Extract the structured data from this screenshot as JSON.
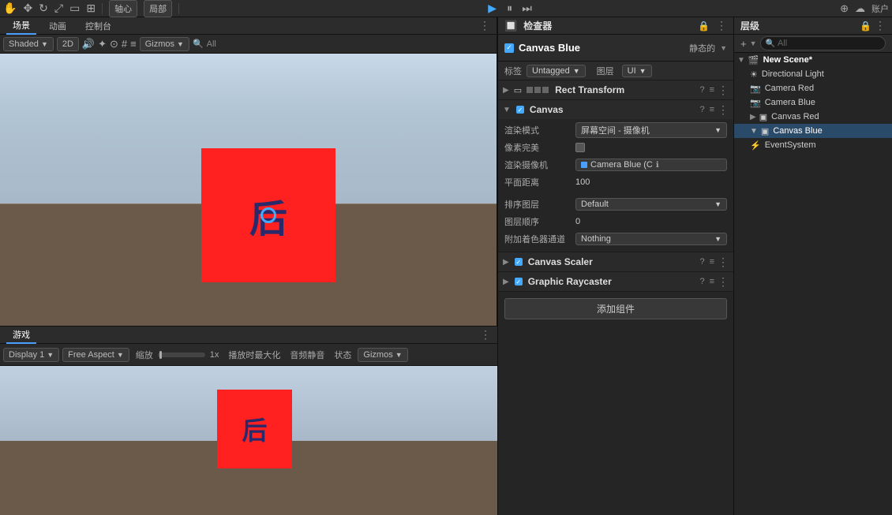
{
  "topbar": {
    "icons": [
      "hand",
      "move",
      "rotate",
      "scale",
      "rect",
      "transform"
    ],
    "axis_label": "轴心",
    "local_label": "局部",
    "play_btn": "▶",
    "pause_btn": "⏸",
    "step_btn": "⏭",
    "cloud_icon": "☁",
    "account_label": "账户",
    "collab_icon": "⊕",
    "settings_icon": "⚙"
  },
  "second_toolbar": {
    "shaded": "Shaded",
    "two_d": "2D",
    "gizmos": "Gizmos",
    "all": "All"
  },
  "left_panels": {
    "scene_tab": "场景",
    "animation_tab": "动画",
    "control_tab": "控制台"
  },
  "game_panel": {
    "tab": "游戏",
    "display": "Display 1",
    "aspect": "Free Aspect",
    "scale_label": "缩放",
    "scale_value": "1x",
    "maximize_label": "播放时最大化",
    "mute_label": "音频静音",
    "status_label": "状态",
    "gizmos_label": "Gizmos"
  },
  "inspector": {
    "title": "检查器",
    "object_name": "Canvas Blue",
    "static_label": "静态的",
    "tag_label": "标签",
    "tag_value": "Untagged",
    "layer_label": "图层",
    "layer_value": "UI",
    "components": {
      "rect_transform": {
        "title": "Rect Transform"
      },
      "canvas": {
        "title": "Canvas",
        "render_mode_label": "渲染模式",
        "render_mode_value": "屏幕空间 - 摄像机",
        "pixel_perfect_label": "像素完美",
        "render_camera_label": "渲染摄像机",
        "render_camera_value": "Camera Blue (C",
        "plane_distance_label": "平面距离",
        "plane_distance_value": "100",
        "sort_layer_label": "排序图层",
        "sort_layer_value": "Default",
        "layer_order_label": "图层顺序",
        "layer_order_value": "0",
        "add_shader_label": "附加着色器通道",
        "add_shader_value": "Nothing"
      },
      "canvas_scaler": {
        "title": "Canvas Scaler"
      },
      "graphic_raycaster": {
        "title": "Graphic Raycaster"
      }
    },
    "add_component_btn": "添加组件"
  },
  "hierarchy": {
    "title": "层级",
    "search_placeholder": "All",
    "add_btn": "+",
    "root_scene": "New Scene*",
    "items": [
      {
        "label": "Directional Light",
        "depth": 1,
        "icon": "☀",
        "has_children": false
      },
      {
        "label": "Camera Red",
        "depth": 1,
        "icon": "📷",
        "has_children": false
      },
      {
        "label": "Camera Blue",
        "depth": 1,
        "icon": "📷",
        "has_children": false
      },
      {
        "label": "Canvas Red",
        "depth": 1,
        "icon": "▣",
        "has_children": true,
        "expanded": false
      },
      {
        "label": "Canvas Blue",
        "depth": 1,
        "icon": "▣",
        "has_children": true,
        "expanded": true,
        "selected": true
      },
      {
        "label": "EventSystem",
        "depth": 1,
        "icon": "⚡",
        "has_children": false
      }
    ]
  },
  "scene": {
    "chinese_char": "后",
    "circle_visible": true
  },
  "game": {
    "chinese_char": "后"
  }
}
